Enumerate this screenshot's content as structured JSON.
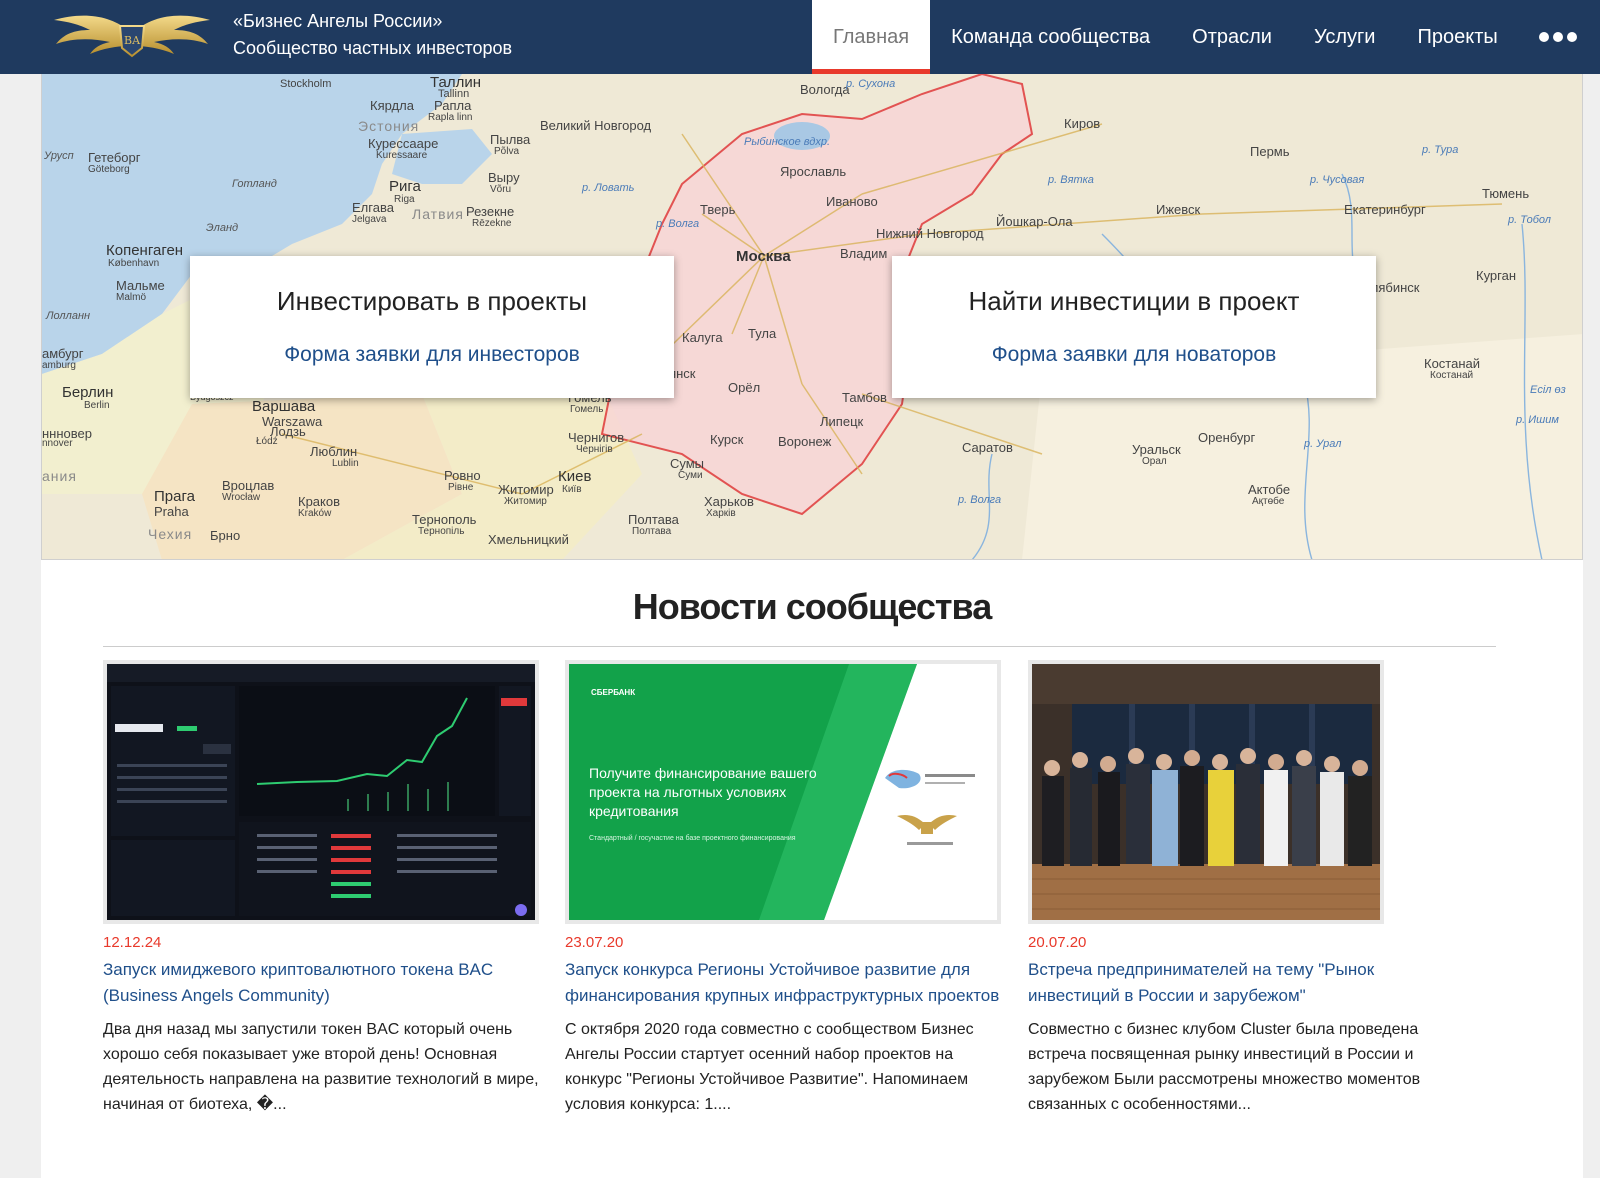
{
  "header": {
    "brand_line1": "«Бизнес Ангелы России»",
    "brand_line2": "Сообщество частных инвесторов",
    "nav": [
      "Главная",
      "Команда сообщества",
      "Отрасли",
      "Услуги",
      "Проекты"
    ],
    "active_nav": "Главная",
    "more_icon": "ellipsis-icon"
  },
  "map": {
    "labels": {
      "tallinn": "Таллин",
      "tallinn_sub": "Tallinn",
      "stockholm": "Stockholm",
      "kardla": "Кярдла",
      "rapla": "Рапла",
      "rapla_sub": "Rapla linn",
      "estonia": "Эстония",
      "kuressaare": "Курессааре",
      "kuressaare_sub": "Kuressaare",
      "pylva": "Пылва",
      "pylva_sub": "Põlva",
      "vyru": "Выру",
      "vyru_sub": "Võru",
      "velikiy_novgorod": "Великий Новгород",
      "vologda": "Вологда",
      "sukhona": "р. Сухона",
      "rybinsk": "Рыбинское вдхр.",
      "kirov": "Киров",
      "perm": "Пермь",
      "tura": "р. Тура",
      "chusovaya": "р. Чусовая",
      "vyatka": "р. Вятка",
      "tyumen": "Тюмень",
      "yekaterinburg": "Екатеринбург",
      "izhevsk": "Ижевск",
      "yoshkar": "Йошкар-Ола",
      "tobol": "р. Тобол",
      "yaroslavl": "Ярославль",
      "ivanovo": "Иваново",
      "tver": "Тверь",
      "lovat": "р. Ловать",
      "volga1": "р. Волга",
      "riga": "Рига",
      "riga_sub": "Riga",
      "latvia": "Латвия",
      "rezekne": "Резекне",
      "rezekne_sub": "Rēzekne",
      "jelgava": "Елгава",
      "jelgava_sub": "Jelgava",
      "gotland": "Готланд",
      "eland": "Эланд",
      "urust": "Урусп",
      "goteborg": "Гетеборг",
      "goteborg_sub": "Göteborg",
      "copenhagen": "Копенгаген",
      "copenhagen_sub": "København",
      "malmo": "Мальме",
      "malmo_sub": "Malmö",
      "lolland": "Лолланн",
      "hamburg": "амбург",
      "hamburg_sub": "amburg",
      "nizhny": "Нижний Новгород",
      "moscow": "Москва",
      "vladimir": "Владим",
      "kurgan": "Курган",
      "chelyabinsk": "елябинск",
      "kaluga": "Калуга",
      "tula": "Тула",
      "bryansk": "рянск",
      "orel": "Орёл",
      "tambov": "Тамбов",
      "lipetsk": "Липецк",
      "kostanay": "Костанай",
      "kostanay_sub": "Костанай",
      "ishim": "р. Ишим",
      "esil": "Есіл өз",
      "berlin": "Берлин",
      "berlin_sub": "Berlin",
      "warsaw": "Варшава",
      "warsaw_sub": "Warszawa",
      "lodz": "Лодзь",
      "lodz_sub": "Łódź",
      "bydgoszcz": "Bydgoszcz",
      "hannover": "ннновер",
      "hannover_sub": "nnover",
      "gomel": "Гомель",
      "gomel_sub": "Гомель",
      "chernigov": "Чернигов",
      "chernigov_sub": "Чернігів",
      "kursk": "Курск",
      "voronezh": "Воронеж",
      "saratov": "Саратов",
      "uralsk": "Уральск",
      "uralsk_sub": "Орал",
      "orenburg": "Оренбург",
      "ural": "р. Урал",
      "lublin": "Люблин",
      "lublin_sub": "Lublin",
      "rovno": "Ровно",
      "rovno_sub": "Рівне",
      "kiev": "Киев",
      "kiev_sub": "Київ",
      "zhitomir": "Житомир",
      "zhitomir_sub": "Житомир",
      "sumy": "Сумы",
      "sumy_sub": "Суми",
      "kharkov": "Харьков",
      "kharkov_sub": "Харків",
      "volga2": "р. Волга",
      "aktobe": "Актобе",
      "aktobe_sub": "Ақтөбе",
      "germany": "ания",
      "wroclaw": "Вроцлав",
      "wroclaw_sub": "Wrocław",
      "prague": "Прага",
      "prague_sub": "Praha",
      "krakow": "Краков",
      "krakow_sub": "Kraków",
      "ternopol": "Тернополь",
      "ternopol_sub": "Тернопіль",
      "poltava": "Полтава",
      "poltava_sub": "Полтава",
      "czech": "Чехия",
      "brno": "Брно",
      "khmelnitsky": "Хмельницкий"
    }
  },
  "cta_invest": {
    "title": "Инвестировать в проекты",
    "link": "Форма заявки для инвесторов"
  },
  "cta_find": {
    "title": "Найти инвестиции в проект",
    "link": "Форма заявки для новаторов"
  },
  "news": {
    "heading": "Новости сообщества",
    "items": [
      {
        "date": "12.12.24",
        "title": "Запуск имиджевого криптовалютного токена BAC (Business Angels Community)",
        "text": "Два дня назад мы запустили токен BAC который очень хорошо себя показывает уже второй день! Основная деятельность направлена на развитие технологий в мире, начиная от биотеха, �..."
      },
      {
        "date": "23.07.20",
        "title": "Запуск конкурса Регионы Устойчивое развитие для финансирования крупных инфраструктурных проектов",
        "text": "  С октября 2020 года совместно с сообществом Бизнес Ангелы России стартует осенний набор проектов на конкурс \"Регионы Устойчивое Развитие\". Напоминаем условия конкурса: 1...."
      },
      {
        "date": "20.07.20",
        "title": "Встреча предпринимателей на тему \"Рынок инвестиций в России и зарубежом\"",
        "text": "  Совместно с бизнес клубом Cluster была проведена встреча посвященная рынку инвестиций в России и зарубежом Были рассмотрены множество моментов связанных с особенностями..."
      }
    ],
    "thumb2": {
      "logo": "СБЕРБАНК",
      "headline": "Получите финансирование вашего проекта на льготных условиях кредитования",
      "small": "Стандартный / госучастие на базе проектного финансирования"
    }
  },
  "colors": {
    "header_bg": "#1f3a5f",
    "accent_red": "#e8392b",
    "link_blue": "#1f4f8a"
  }
}
